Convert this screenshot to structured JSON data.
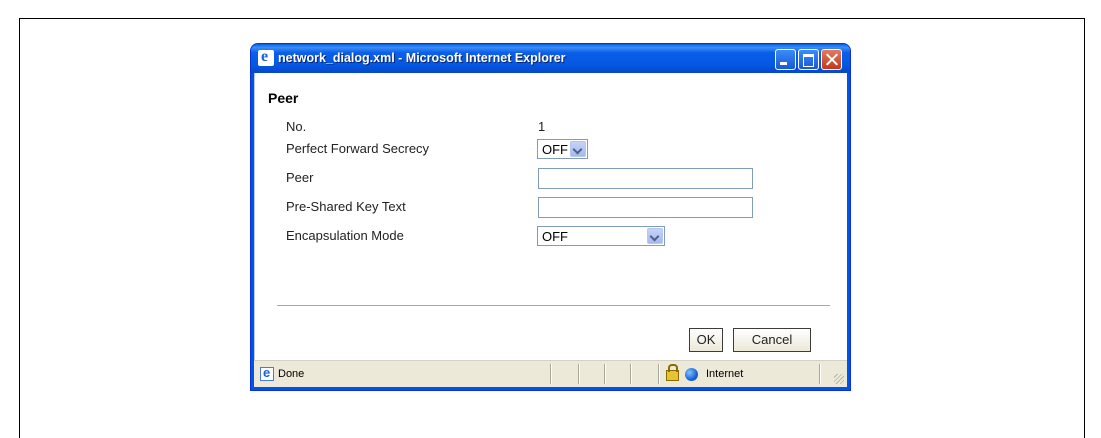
{
  "window": {
    "title": "network_dialog.xml - Microsoft Internet Explorer"
  },
  "dialog": {
    "section_title": "Peer",
    "rows": {
      "no": {
        "label": "No.",
        "value": "1"
      },
      "pfs": {
        "label": "Perfect Forward Secrecy",
        "selected": "OFF"
      },
      "peer": {
        "label": "Peer",
        "value": ""
      },
      "psk": {
        "label": "Pre-Shared Key Text",
        "value": ""
      },
      "encap": {
        "label": "Encapsulation Mode",
        "selected": "OFF"
      }
    },
    "buttons": {
      "ok": "OK",
      "cancel": "Cancel"
    }
  },
  "statusbar": {
    "status": "Done",
    "zone": "Internet"
  },
  "icons": [
    "ie-icon",
    "minimize-icon",
    "maximize-icon",
    "close-icon",
    "dropdown-arrow-icon",
    "lock-icon",
    "globe-icon",
    "resize-grip-icon"
  ],
  "colors": {
    "titlebar": "#0054e3",
    "statusbar": "#ece9d8",
    "close": "#c1391a"
  }
}
